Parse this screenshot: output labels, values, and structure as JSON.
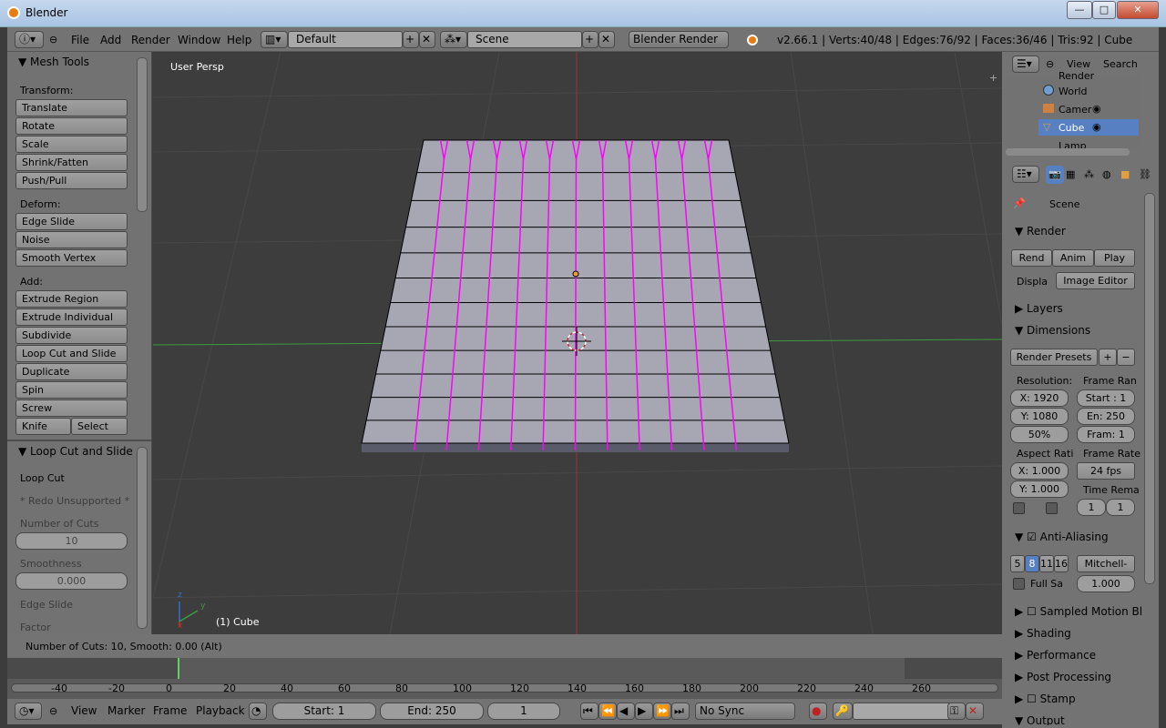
{
  "window": {
    "title": "Blender",
    "min": "—",
    "max": "□",
    "close": "✕"
  },
  "header": {
    "menus": [
      "File",
      "Add",
      "Render",
      "Window",
      "Help"
    ],
    "layout": "Default",
    "scene": "Scene",
    "engine": "Blender Render",
    "status": "v2.66.1 | Verts:40/48 | Edges:76/92 | Faces:36/46 | Tris:92 | Cube"
  },
  "toolshelf": {
    "title": "Mesh Tools",
    "transform_label": "Transform:",
    "transform": [
      "Translate",
      "Rotate",
      "Scale",
      "Shrink/Fatten",
      "Push/Pull"
    ],
    "deform_label": "Deform:",
    "deform": [
      "Edge Slide",
      "Noise",
      "Smooth Vertex"
    ],
    "add_label": "Add:",
    "add": [
      "Extrude Region",
      "Extrude Individual",
      "Subdivide",
      "Loop Cut and Slide",
      "Duplicate",
      "Spin",
      "Screw"
    ],
    "knife": "Knife",
    "select": "Select",
    "op_title": "Loop Cut and Slide",
    "op_loopcut": "Loop Cut",
    "op_redo": "* Redo Unsupported *",
    "cuts_label": "Number of Cuts",
    "cuts_value": "10",
    "smooth_label": "Smoothness",
    "smooth_value": "0.000",
    "edge_slide": "Edge Slide",
    "factor": "Factor"
  },
  "viewport": {
    "view_name": "User Persp",
    "object": "(1) Cube",
    "axis_z": "z",
    "axis_y": "y",
    "axis_x": "x"
  },
  "outliner": {
    "view": "View",
    "search": "Search",
    "items": [
      "Render",
      "World",
      "Camer",
      "Cube",
      "Lamp"
    ]
  },
  "properties": {
    "scene": "Scene",
    "render": "Render",
    "rend": "Rend",
    "anim": "Anim",
    "play": "Play",
    "display_label": "Displa",
    "display_value": "Image Editor",
    "layers": "Layers",
    "dimensions": "Dimensions",
    "presets": "Render Presets",
    "resolution": "Resolution:",
    "frame_range": "Frame Ran",
    "res_x": "X: 1920",
    "res_y": "Y: 1080",
    "res_pct": "50%",
    "start": "Start : 1",
    "end": "En: 250",
    "frame": "Fram: 1",
    "aspect": "Aspect Rati",
    "frame_rate": "Frame Rate",
    "asp_x": "X: 1.000",
    "asp_y": "Y: 1.000",
    "fps": "24 fps",
    "time_remap": "Time Rema",
    "tr_old": "1",
    "tr_new": "1",
    "aa": "Anti-Aliasing",
    "aa_samples": [
      "5",
      "8",
      "11",
      "16"
    ],
    "aa_filter": "Mitchell-",
    "full_sample": "Full Sa",
    "filter_size": "1.000",
    "motion_blur": "Sampled Motion Bl",
    "shading": "Shading",
    "performance": "Performance",
    "post": "Post Processing",
    "stamp": "Stamp",
    "output": "Output"
  },
  "opbar": {
    "text": "Number of Cuts: 10, Smooth: 0.00 (Alt)"
  },
  "timeline": {
    "ticks": [
      "-40",
      "-20",
      "0",
      "20",
      "40",
      "60",
      "80",
      "100",
      "120",
      "140",
      "160",
      "180",
      "200",
      "220",
      "240",
      "260"
    ],
    "menus": [
      "View",
      "Marker",
      "Frame",
      "Playback"
    ],
    "start": "Start: 1",
    "end": "End: 250",
    "current": "1",
    "sync": "No Sync"
  },
  "colors": {
    "accent_blue": "#5680c2",
    "edge_selected": "#ff00ff",
    "green_axis": "#3e9a3e",
    "red_axis": "#a03030"
  }
}
